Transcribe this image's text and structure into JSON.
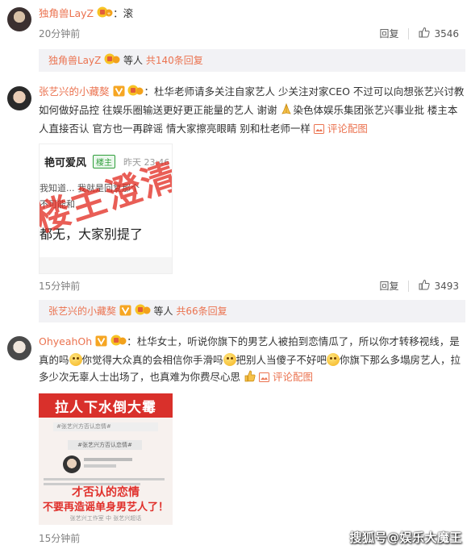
{
  "comments": [
    {
      "username": "独角兽LayZ",
      "separator": "：",
      "text": "滚",
      "time": "20分钟前",
      "reply_label": "回复",
      "likes": "3546",
      "thread": {
        "name": "独角兽LayZ",
        "middle": " 等人 ",
        "count": "共140条回复"
      }
    },
    {
      "username": "张艺兴的小藏獒",
      "separator": "：",
      "text": "杜华老师请多关注自家艺人 少关注对家CEO  不过可以向想张艺兴讨教如何做好品控 往娱乐圈输送更好更正能量的艺人 谢谢",
      "text2": "染色体娱乐集团张艺兴事业批 楼主本人直接否认 官方也一再辟谣 情大家擦亮眼睛 别和杜老师一样",
      "pic_link": "评论配图",
      "image": {
        "line1_name": "艳可爱风",
        "line1_tag": "楼主",
        "line1_time": "昨天 23:46",
        "line2": "我知道... 我就是回复那个",
        "line3": "不可能和",
        "line4": "都无，大家别提了",
        "stamp": "楼主澄清"
      },
      "time": "15分钟前",
      "reply_label": "回复",
      "likes": "3493",
      "thread": {
        "name": "张艺兴的小藏獒",
        "middle": " 等人 ",
        "count": "共66条回复"
      }
    },
    {
      "username": "OhyeahOh",
      "separator": "：",
      "text_a": "杜华女士，听说你旗下的男艺人被拍到恋情瓜了，所以你才转移视线，是真的吗",
      "text_b": "你觉得大众真的会相信你手滑吗",
      "text_c": "把别人当傻子不好吧",
      "text_d": "你旗下那么多塌房艺人，拉多少次无辜人士出场了，也真难为你费尽心思",
      "pic_link": "评论配图",
      "image": {
        "banner": "拉人下水倒大霉",
        "hashtag": "#张艺兴方否认恋情#",
        "subtag": "#张艺兴方否认恋情#",
        "headline1": "才否认的恋情",
        "headline2": "不要再造谣单身男艺人了！",
        "footer": "张艺兴工作室 中 张艺兴超话"
      },
      "time": "15分钟前"
    }
  ],
  "watermark": "搜狐号@娱乐大魔王",
  "colors": {
    "accent": "#eb7350",
    "reply_bg": "#f2f2f5",
    "meta": "#808080"
  }
}
